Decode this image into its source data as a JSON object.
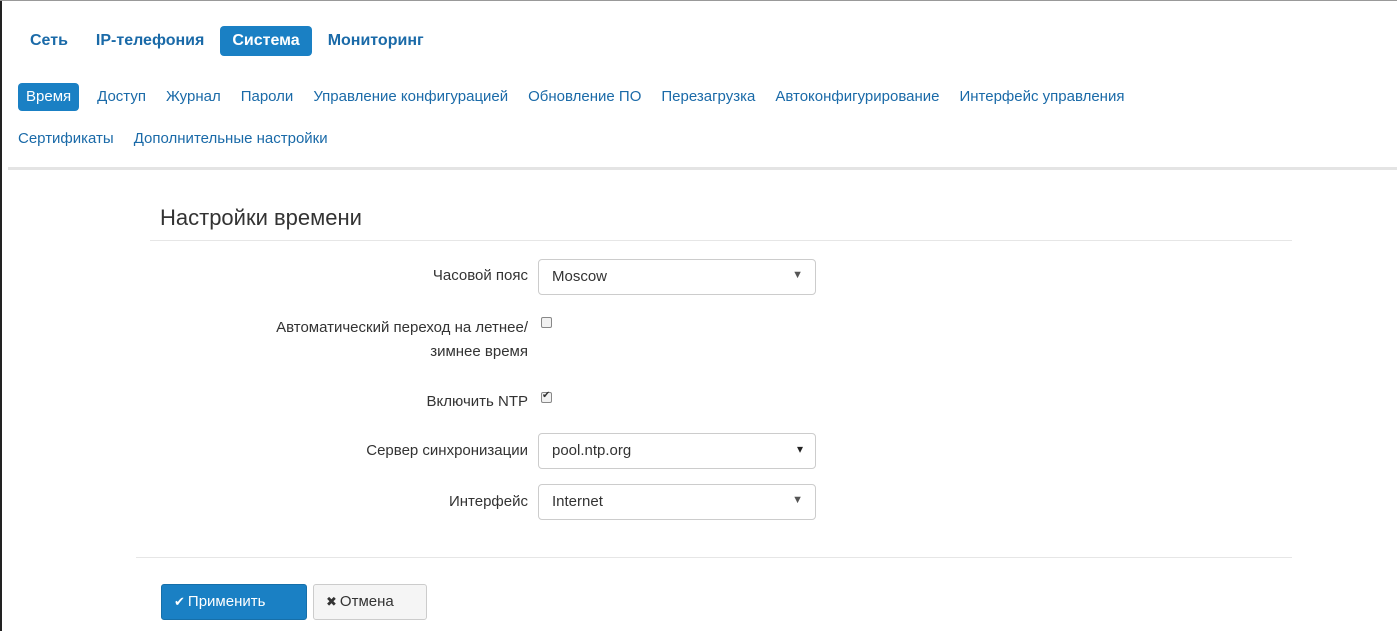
{
  "nav": {
    "top_tabs": [
      "Сеть",
      "IP-телефония",
      "Система",
      "Мониторинг"
    ],
    "active_top_tab": "Система",
    "sub_tabs_row1": [
      "Время",
      "Доступ",
      "Журнал",
      "Пароли",
      "Управление конфигурацией",
      "Обновление ПО",
      "Перезагрузка",
      "Автоконфигурирование",
      "Интерфейс управления"
    ],
    "sub_tabs_row2": [
      "Сертификаты",
      "Дополнительные настройки"
    ],
    "active_sub_tab": "Время"
  },
  "section": {
    "title": "Настройки времени"
  },
  "form": {
    "timezone_label": "Часовой пояс",
    "timezone_value": "Moscow",
    "dst_label_line1": "Автоматический переход на летнее/",
    "dst_label_line2": "зимнее время",
    "dst_checked": false,
    "ntp_label": "Включить NTP",
    "ntp_checked": true,
    "server_label": "Сервер синхронизации",
    "server_value": "pool.ntp.org",
    "interface_label": "Интерфейс",
    "interface_value": "Internet"
  },
  "buttons": {
    "apply_label": "Применить",
    "cancel_label": "Отмена"
  },
  "colors": {
    "accent": "#1a80c4",
    "link": "#1a6aa8"
  }
}
